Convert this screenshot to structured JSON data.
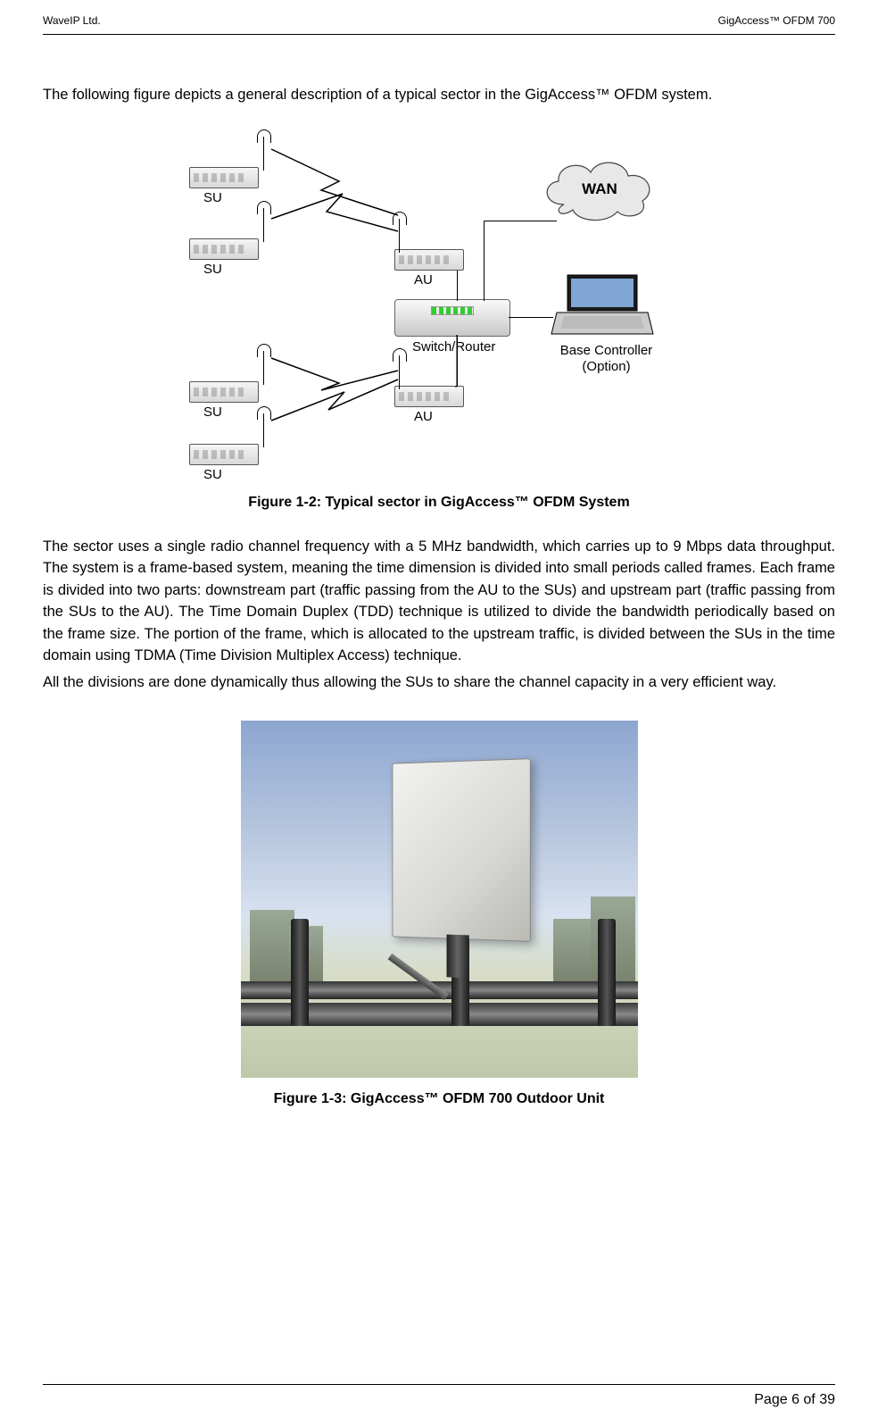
{
  "header": {
    "left": "WaveIP Ltd.",
    "right": "GigAccess™ OFDM 700"
  },
  "intro": "The following figure depicts a general description of a typical sector in the GigAccess™ OFDM system.",
  "diagram": {
    "su": "SU",
    "au": "AU",
    "switch": "Switch/Router",
    "base": "Base Controller (Option)",
    "wan": "WAN"
  },
  "caption1": "Figure 1-2: Typical sector in GigAccess™ OFDM System",
  "para1": "The sector uses a single radio channel frequency with a 5 MHz bandwidth, which carries up to 9 Mbps data throughput. The system is a frame-based system, meaning the time dimension is divided into small periods called frames. Each frame is divided into two parts: downstream part (traffic passing from the AU to the SUs) and upstream part (traffic passing from the SUs to the AU). The Time Domain Duplex (TDD) technique is utilized to divide the bandwidth periodically based on the frame size. The portion of the frame, which is allocated to the upstream traffic, is divided between the SUs in the time domain using TDMA (Time Division Multiplex Access) technique.",
  "para2": "All the divisions are done dynamically thus allowing the SUs to share the channel capacity in a very efficient way.",
  "caption2": "Figure 1-3: GigAccess™ OFDM 700  Outdoor Unit",
  "footer": "Page 6 of 39"
}
